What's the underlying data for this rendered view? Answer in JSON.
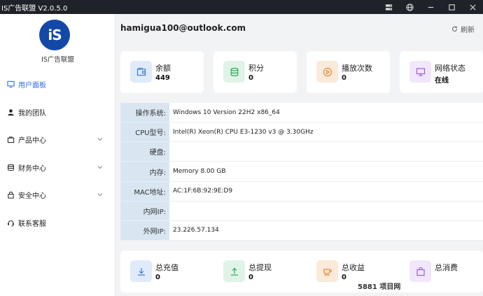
{
  "window": {
    "title": "IS广告联盟 V2.0.5.0"
  },
  "sidebar": {
    "logo_text": "iS",
    "brand": "IS广告联盟",
    "items": [
      {
        "label": "用户面板",
        "icon": "monitor-icon",
        "active": true
      },
      {
        "label": "我的团队",
        "icon": "user-icon"
      },
      {
        "label": "产品中心",
        "icon": "bag-icon",
        "expandable": true
      },
      {
        "label": "财务中心",
        "icon": "database-icon",
        "expandable": true
      },
      {
        "label": "安全中心",
        "icon": "lock-icon",
        "expandable": true
      },
      {
        "label": "联系客服",
        "icon": "service-icon"
      }
    ]
  },
  "main": {
    "email": "hamigua100@outlook.com",
    "refresh_label": "刷新",
    "stats": [
      {
        "label": "余额",
        "value": "449",
        "icon": "wallet-icon",
        "color": "#3b7dd8",
        "bg": "#dfeafb"
      },
      {
        "label": "积分",
        "value": "0",
        "icon": "coins-icon",
        "color": "#2eaa5c",
        "bg": "#dff3e6"
      },
      {
        "label": "播放次数",
        "value": "0",
        "icon": "play-icon",
        "color": "#e8883a",
        "bg": "#fbe9d9"
      },
      {
        "label": "网络状态",
        "value": "在线",
        "icon": "screen-icon",
        "color": "#a259e0",
        "bg": "#f1e6fb"
      }
    ],
    "system_info": [
      {
        "label": "操作系统:",
        "value": "Windows 10 Version 22H2 x86_64"
      },
      {
        "label": "CPU型号:",
        "value": "Intel(R) Xeon(R) CPU E3-1230 v3 @ 3.30GHz"
      },
      {
        "label": "硬盘:",
        "value": ""
      },
      {
        "label": "内存:",
        "value": "Memory 8.00 GB"
      },
      {
        "label": "MAC地址:",
        "value": "AC:1F:6B:92:9E:D9"
      },
      {
        "label": "内网IP:",
        "value": ""
      },
      {
        "label": "外网IP:",
        "value": "23.226.57.134"
      }
    ],
    "totals": [
      {
        "label": "总充值",
        "value": "0",
        "icon": "download-icon",
        "color": "#3b7dd8",
        "bg": "#dfeafb"
      },
      {
        "label": "总提现",
        "value": "0",
        "icon": "upload-icon",
        "color": "#2eaa5c",
        "bg": "#dff3e6"
      },
      {
        "label": "总收益",
        "value": "0",
        "icon": "cup-icon",
        "color": "#e8883a",
        "bg": "#fbe9d9"
      },
      {
        "label": "总消费",
        "value": "",
        "icon": "shopping-bag-icon",
        "color": "#a259e0",
        "bg": "#f1e6fb"
      }
    ]
  },
  "watermark": "5881 项目网"
}
